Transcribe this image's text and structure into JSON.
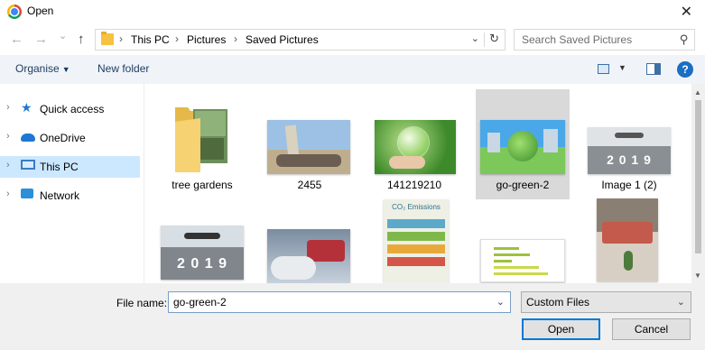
{
  "window": {
    "title": "Open",
    "close_glyph": "✕"
  },
  "nav": {
    "back_glyph": "←",
    "forward_glyph": "→",
    "recent_glyph": "⌄",
    "up_glyph": "↑",
    "breadcrumb": [
      "This PC",
      "Pictures",
      "Saved Pictures"
    ],
    "separator": "›",
    "dropdown_glyph": "⌄",
    "refresh_glyph": "↻",
    "search_placeholder": "Search Saved Pictures",
    "search_glyph": "⚲"
  },
  "toolbar": {
    "organise_label": "Organise",
    "organise_caret": "▼",
    "new_folder_label": "New folder",
    "view_caret": "▼",
    "help_label": "?"
  },
  "sidebar": {
    "chevron": "›",
    "items": [
      {
        "label": "Quick access",
        "icon": "star-icon"
      },
      {
        "label": "OneDrive",
        "icon": "cloud-icon"
      },
      {
        "label": "This PC",
        "icon": "computer-icon"
      },
      {
        "label": "Network",
        "icon": "network-icon"
      }
    ]
  },
  "files": [
    {
      "label": "tree gardens",
      "kind": "folder"
    },
    {
      "label": "2455",
      "kind": "image"
    },
    {
      "label": "141219210",
      "kind": "image"
    },
    {
      "label": "go-green-2",
      "kind": "image",
      "selected": true
    },
    {
      "label": "Image 1 (2)",
      "kind": "image"
    },
    {
      "label": "",
      "kind": "image"
    },
    {
      "label": "",
      "kind": "image"
    },
    {
      "label": "",
      "kind": "image"
    },
    {
      "label": "",
      "kind": "image"
    },
    {
      "label": "",
      "kind": "image"
    }
  ],
  "thumbnail_text": {
    "runway_year": "2 0 1 9",
    "co2_title": "CO₂ Emissions"
  },
  "scrollbar": {
    "up_glyph": "▲",
    "down_glyph": "▼"
  },
  "bottom": {
    "file_name_label": "File name:",
    "file_name_value": "go-green-2",
    "file_name_dropdown": "⌄",
    "file_type_value": "Custom Files",
    "file_type_dropdown": "⌄",
    "open_label": "Open",
    "cancel_label": "Cancel"
  },
  "colors": {
    "selection": "#cce8ff",
    "selected_tile": "#d9d9d9",
    "accent": "#0078d7",
    "toolbar_bg": "#f0f4f9"
  }
}
